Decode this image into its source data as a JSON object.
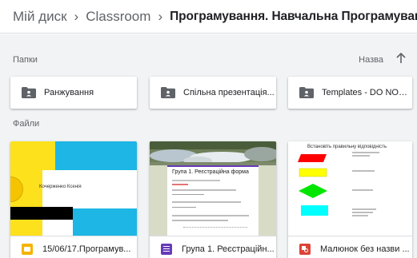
{
  "breadcrumb": {
    "root": "Мій диск",
    "middle": "Classroom",
    "current": "Програмування. Навчальна Програмування"
  },
  "folders_section": {
    "label": "Папки",
    "sort_label": "Назва"
  },
  "folders": [
    {
      "label": "Ранжування"
    },
    {
      "label": "Спільна презентація..."
    },
    {
      "label": "Templates - DO NOT ..."
    }
  ],
  "files_section": {
    "label": "Файли"
  },
  "files": [
    {
      "label": "15/06/17.Програмув...",
      "type_icon": "slides-icon",
      "type_color": "#f4b400",
      "thumb_title": "Кочерженко Ксенія"
    },
    {
      "label": "Група 1. Реєстраційн...",
      "type_icon": "forms-icon",
      "type_color": "#673ab7",
      "thumb_title": "Група 1. Реєстраційна форма"
    },
    {
      "label": "Малюнок без назви ...",
      "type_icon": "drawings-icon",
      "type_color": "#db4437",
      "thumb_title": "Встановіть правильну відповідність"
    }
  ],
  "colors": {
    "accent_yellow": "#fde11d",
    "accent_cyan": "#1db6e5",
    "draw_red": "#ff0000",
    "draw_yellow": "#ffff00",
    "draw_green": "#00e600",
    "draw_cyan": "#00ffff"
  }
}
